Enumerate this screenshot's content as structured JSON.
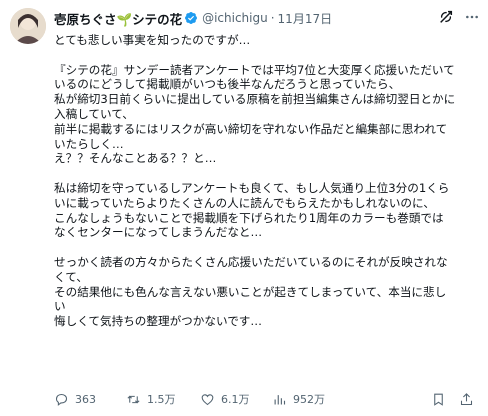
{
  "author": {
    "display_name": "壱原ちぐさ🌱シテの花",
    "handle": "@ichichigu",
    "separator": "·",
    "date": "11月17日",
    "verified": true
  },
  "header_icons": [
    "grok-icon",
    "more-icon"
  ],
  "tweet_lines": [
    "とても悲しい事実を知ったのですが…",
    "",
    "『シテの花』サンデー読者アンケートでは平均7位と大変厚く応援いただいて",
    "いるのにどうして掲載順がいつも後半なんだろうと思っていたら、",
    "私が締切3日前くらいに提出している原稿を前担当編集さんは締切翌日とかに",
    "入稿していて、",
    "前半に掲載するにはリスクが高い締切を守れない作品だと編集部に思われて",
    "いたらしく…",
    "え？？そんなことある？？と…",
    "",
    "私は締切を守っているしアンケートも良くて、もし人気通り上位3分の1くら",
    "いに載っていたらよりたくさんの人に読んでもらえたかもしれないのに、",
    "こんなしょうもないことで掲載順を下げられたり1周年のカラーも巻頭では",
    "なくセンターになってしまうんだなと…",
    "",
    "せっかく読者の方々からたくさん応援いただいているのにそれが反映されな",
    "くて、",
    "その結果他にも色んな言えない悪いことが起きてしまっていて、本当に悲し",
    "い",
    "悔しくて気持ちの整理がつかないです…"
  ],
  "actions": {
    "replies": "363",
    "retweets": "1.5万",
    "likes": "6.1万",
    "views": "952万"
  },
  "colors": {
    "text": "#0f1419",
    "secondary": "#536471",
    "verified": "#1d9bf0"
  }
}
